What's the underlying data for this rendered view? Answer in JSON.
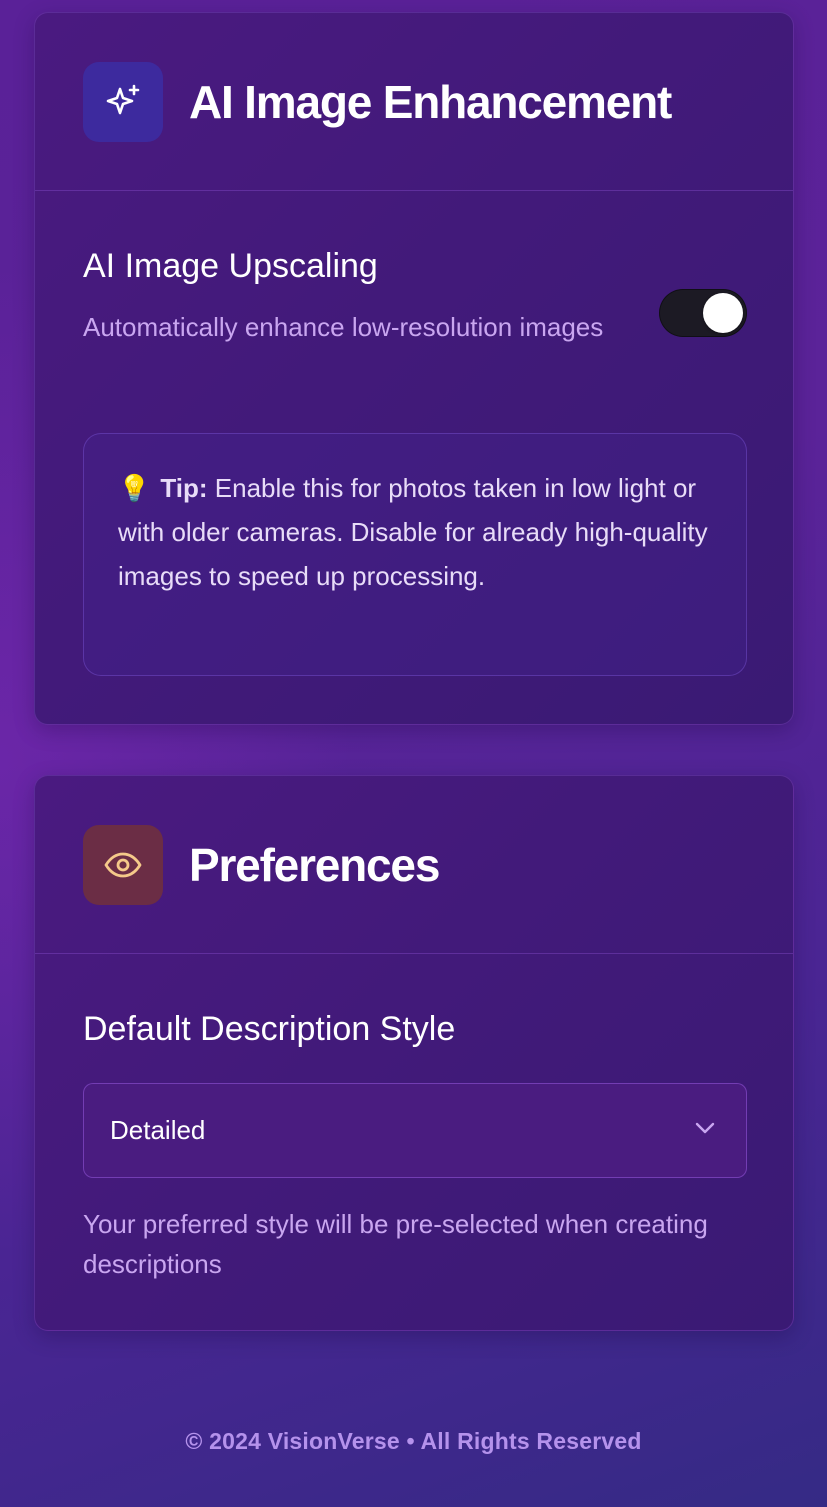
{
  "ai_card": {
    "icon": "sparkles-icon",
    "title": "AI Image Enhancement",
    "setting_title": "AI Image Upscaling",
    "setting_desc": "Automatically enhance low-resolution images",
    "toggle_on": true,
    "tip": {
      "icon": "lightbulb-icon",
      "emoji": "💡",
      "label": "Tip:",
      "text": " Enable this for photos taken in low light or with older cameras. Disable for already high-quality images to speed up processing."
    }
  },
  "pref_card": {
    "icon": "eye-icon",
    "title": "Preferences",
    "label": "Default Description Style",
    "select_value": "Detailed",
    "hint": "Your preferred style will be pre-selected when creating descriptions"
  },
  "footer": {
    "text": "© 2024 VisionVerse • All Rights Reserved"
  },
  "colors": {
    "ai_icon_bg": "#3d2a9e",
    "pref_icon_bg": "#6b2d45",
    "pref_icon_color": "#f5c98a",
    "muted_text": "#c9a6f0",
    "footer_text": "#b592ec"
  }
}
